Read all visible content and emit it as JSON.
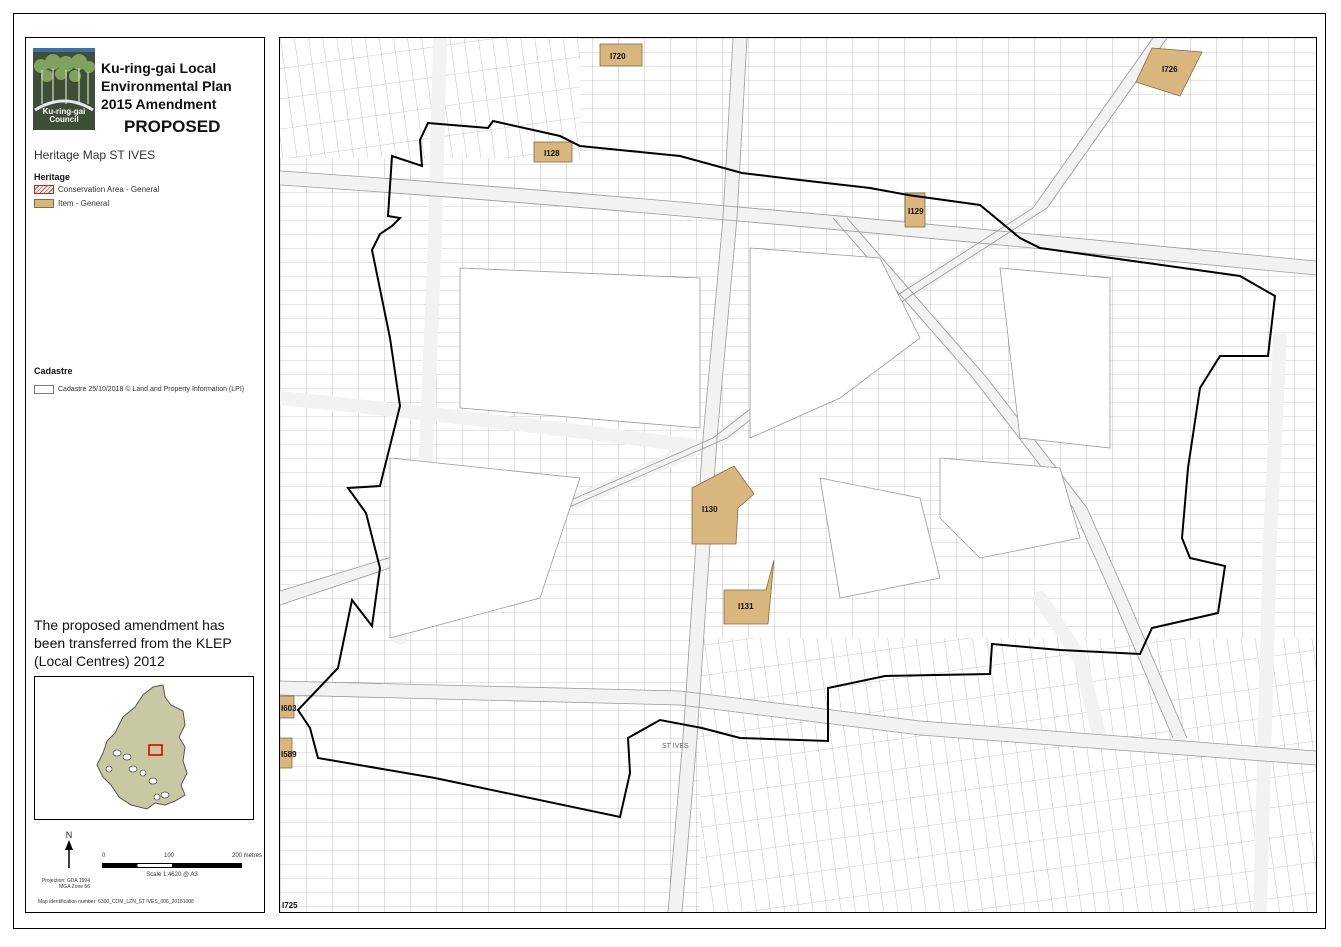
{
  "legend": {
    "title_lines": [
      "Ku-ring-gai Local",
      "Environmental Plan",
      "2015 Amendment"
    ],
    "status": "PROPOSED",
    "logo_text": [
      "Ku-ring-gai",
      "Council"
    ],
    "map_name": "Heritage Map ST IVES",
    "heritage_heading": "Heritage",
    "heritage_items": [
      {
        "label": "Conservation Area - General",
        "swatch": "hatch-red"
      },
      {
        "label": "Item - General",
        "swatch": "#d8b67e"
      }
    ],
    "cadastre_heading": "Cadastre",
    "cadastre_item": "Cadastre 25/10/2018 © Land and Property Information (LPI)",
    "note": "The proposed amendment has been transferred from the KLEP (Local Centres) 2012",
    "north_label": "N",
    "scale_ticks": [
      "0",
      "100",
      "200 metres"
    ],
    "scale_text": "Scale 1:4620 @ A3",
    "projection": [
      "Projection: GDA 1994",
      "MGA Zone 56"
    ],
    "map_id": "Map identification number: 6300_COM_LZN_ST IVES_006_20181008"
  },
  "map": {
    "item_fill": "#d8b67e",
    "boundary_color": "#000000",
    "heritage_items": [
      "I720",
      "I726",
      "I128",
      "I129",
      "I130",
      "I131",
      "I603",
      "I589",
      "I725"
    ],
    "street_labels": [
      "ST IVES"
    ]
  }
}
